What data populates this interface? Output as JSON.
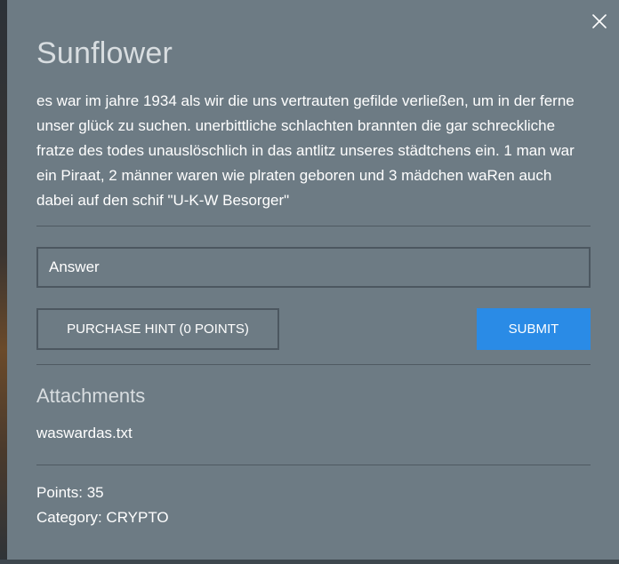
{
  "challenge": {
    "title": "Sunflower",
    "description": "es war im jahre 1934 als wir die uns vertrauten gefilde verließen, um in der ferne unser glück zu suchen. unerbittliche schlachten brannten die gar schreckliche fratze des todes unauslöschlich in das antlitz unseres städtchens ein. 1 man war ein Piraat, 2 männer waren wie plraten geboren und 3 mädchen waRen auch dabei auf den schif \"U-K-W Besorger\""
  },
  "answer": {
    "placeholder": "Answer",
    "value": ""
  },
  "buttons": {
    "hint_label": "PURCHASE HINT (0 POINTS)",
    "submit_label": "SUBMIT"
  },
  "attachments": {
    "heading": "Attachments",
    "files": [
      "waswardas.txt"
    ]
  },
  "meta": {
    "points": "Points: 35",
    "category": "Category: CRYPTO"
  },
  "icons": {
    "close": "close-icon"
  },
  "colors": {
    "modal_bg": "#6d7b84",
    "submit_bg": "#2a8be6",
    "title_text": "#d8dde0",
    "border": "#4c5760"
  }
}
